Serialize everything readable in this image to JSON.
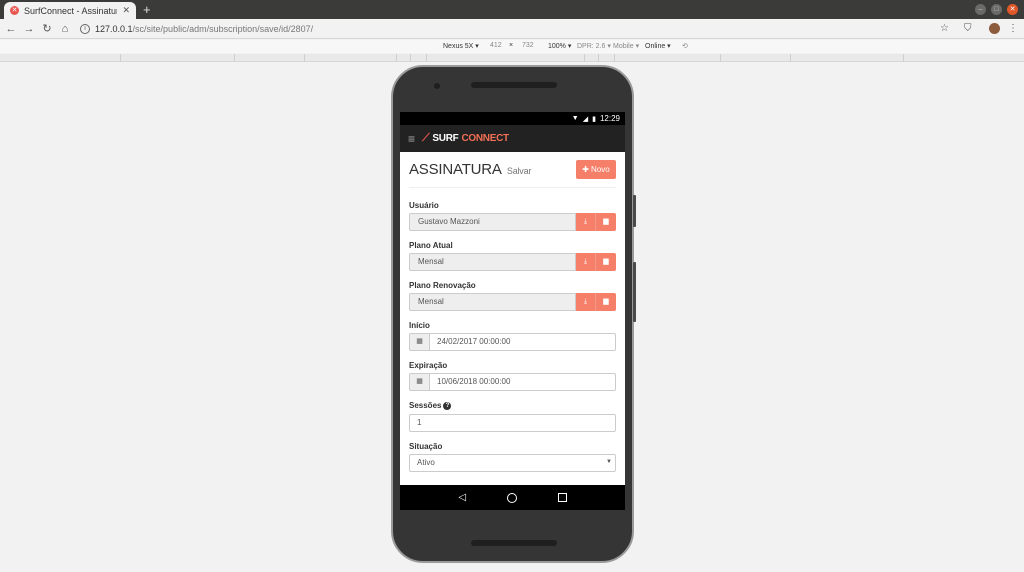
{
  "browser": {
    "tab_title": "SurfConnect - Assinatura",
    "url_host": "127.0.0.1",
    "url_path": "/sc/site/public/adm/subscription/save/id/2807/"
  },
  "devtools": {
    "device": "Nexus 5X",
    "width": "412",
    "times": "×",
    "height": "732",
    "zoom": "100%",
    "dpr": "DPR: 2.6",
    "mode": "Mobile",
    "network": "Online"
  },
  "status": {
    "time": "12:29"
  },
  "app": {
    "logo_part1": "SURF",
    "logo_part2": "CONNECT",
    "page_title": "ASSINATURA",
    "page_subtitle": "Salvar",
    "new_button": "Novo"
  },
  "form": {
    "usuario_label": "Usuário",
    "usuario_value": "Gustavo Mazzoni",
    "plano_atual_label": "Plano Atual",
    "plano_atual_value": "Mensal",
    "plano_renov_label": "Plano Renovação",
    "plano_renov_value": "Mensal",
    "inicio_label": "Início",
    "inicio_value": "24/02/2017 00:00:00",
    "expiracao_label": "Expiração",
    "expiracao_value": "10/06/2018 00:00:00",
    "sessoes_label": "Sessões",
    "sessoes_value": "1",
    "situacao_label": "Situação",
    "situacao_value": "Ativo"
  },
  "icons": {
    "download": "download-icon",
    "trash": "trash-icon",
    "calendar": "calendar-icon",
    "question": "question-icon",
    "plus": "plus-icon"
  },
  "colors": {
    "accent": "#f57f68",
    "brand_red": "#e8574f",
    "appbar": "#222222"
  }
}
